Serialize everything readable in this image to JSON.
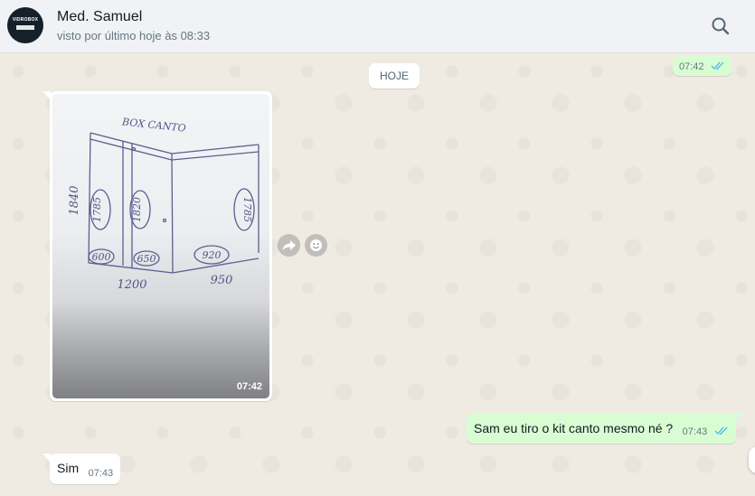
{
  "header": {
    "contact_name": "Med. Samuel",
    "last_seen": "visto por último hoje às 08:33",
    "avatar_logo": "VIDROBOX",
    "avatar_icon": "company-logo"
  },
  "chat": {
    "date_divider": "HOJE",
    "messages": [
      {
        "direction": "out",
        "type": "text",
        "text": "",
        "time": "07:42",
        "status": "read"
      },
      {
        "direction": "in",
        "type": "image",
        "time": "07:42",
        "image": {
          "sketch_title": "BOX CANTO",
          "labels": [
            "1840",
            "1785",
            "1820",
            "1785",
            "600",
            "650",
            "920",
            "1200",
            "950"
          ]
        }
      },
      {
        "direction": "out",
        "type": "text",
        "text": "Sam eu tiro o kit canto mesmo né ?",
        "time": "07:43",
        "status": "read"
      },
      {
        "direction": "in",
        "type": "text",
        "text": "Sim",
        "time": "07:43"
      }
    ]
  },
  "icons": {
    "search": "search-icon",
    "forward": "forward-icon",
    "emoji": "emoji-icon",
    "read_ticks": "double-check-icon"
  },
  "colors": {
    "chat_bg": "#efeae2",
    "header_bg": "#f0f2f5",
    "outgoing_bubble": "#d9fdd3",
    "incoming_bubble": "#ffffff",
    "read_tick": "#53bdeb"
  }
}
